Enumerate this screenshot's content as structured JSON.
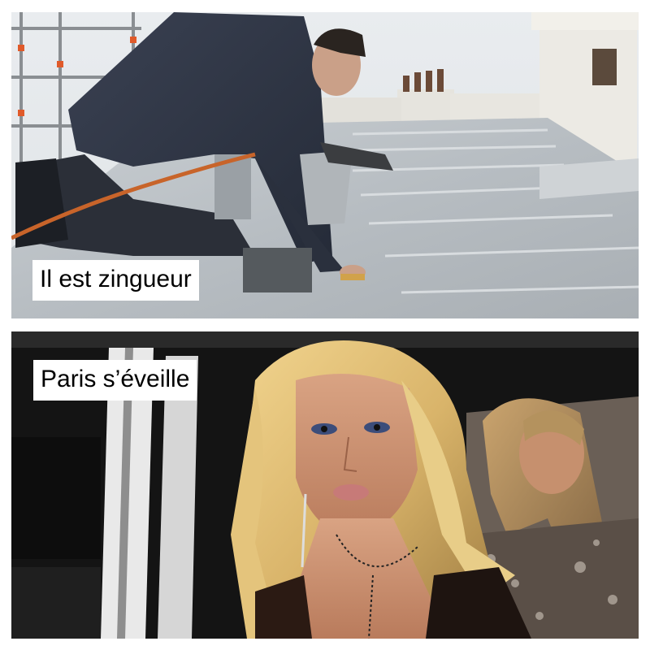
{
  "panels": [
    {
      "caption": "Il est zingueur",
      "scene": "rooftop-zinc-worker"
    },
    {
      "caption": "Paris s’éveille",
      "scene": "woman-in-car-at-night"
    }
  ],
  "colors": {
    "background": "#ffffff",
    "caption_bg": "#ffffff",
    "caption_text": "#000000"
  }
}
